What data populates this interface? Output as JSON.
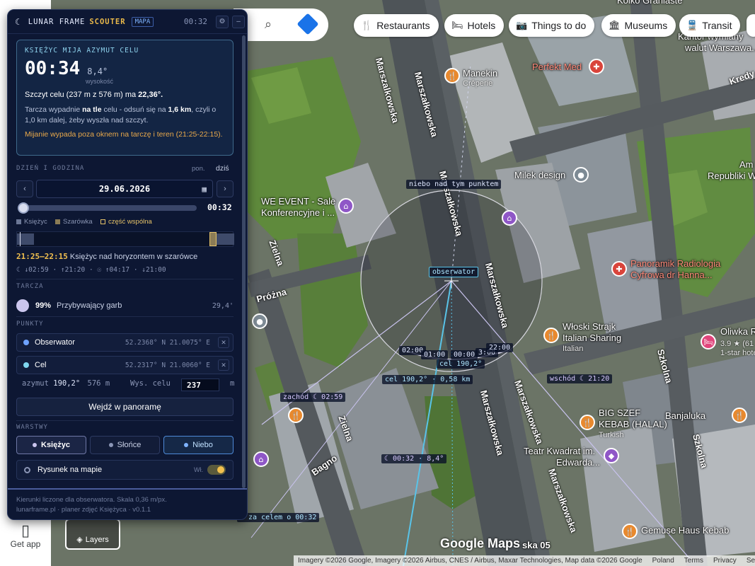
{
  "map": {
    "chips": [
      {
        "icon": "🍴",
        "label": "Restaurants"
      },
      {
        "icon": "🛏",
        "label": "Hotels"
      },
      {
        "icon": "📷",
        "label": "Things to do"
      },
      {
        "icon": "🏛",
        "label": "Museums"
      },
      {
        "icon": "🚆",
        "label": "Transit"
      }
    ],
    "streets": {
      "marsz1": "Marszalkowska",
      "marsz2": "Marszałkowska",
      "marsz3": "Marszałkowska",
      "marsz4": "Marszałkowska",
      "marsz5": "Marszałkowska",
      "marsz6": "Marszałkowska",
      "marsz7": "Marszałkowska",
      "zielna1": "Zielna",
      "zielna2": "Zielna",
      "prozna": "Próżna",
      "bagno": "Bagno",
      "szkolna1": "Szkolna",
      "szkolna2": "Szkolna",
      "kredy": "Kredy",
      "marsz_bottom": "ska 05"
    },
    "pois": {
      "koiko": "Koiko Graniaste",
      "kantor1": "Kantor wymiany",
      "kantor2": "walut Warszawa...",
      "manekin": "Manekin",
      "manekin_sub": "Crêperie",
      "perfekt": "Perfekt Med",
      "milek": "Milek design",
      "ambasada1": "Am",
      "ambasada2": "Republiki W",
      "wevent1": "WE EVENT - Sale",
      "wevent2": "Konferencyjne i ...",
      "panoramik1": "Panoramik Radiologia",
      "panoramik2": "Cyfrowa dr Hanna...",
      "wloski1": "Włoski Strajk",
      "wloski2": "Italian Sharing",
      "wloski_sub": "Italian",
      "oliwka1": "Oliwka R",
      "oliwka_rating": "3.9 ★ (61",
      "oliwka_sub": "1-star hote",
      "bigszef1": "BIG SZEF",
      "bigszef2": "KEBAB (HALAL)",
      "bigszef_sub": "Turkish",
      "banjaluka": "Banjaluka",
      "teatr1": "Teatr Kwadrat im.",
      "teatr2": "Edwarda...",
      "gemuse": "Gemuse Haus Kebab"
    },
    "overlay": {
      "niebo": "niebo nad tym punktem",
      "obserwator": "obserwator",
      "t0200a": "02:00",
      "t0100": "01:00",
      "t0000": "00:00",
      "t0300": "3:00",
      "t2200": "22:00",
      "cel_az": "cel 190,2°",
      "cel_km": "cel 190,2° · 0,58 km",
      "wschod": "wschód ☾ 21:20",
      "zachod": "zachód ☾ 02:59",
      "moon_now": "☾ 00:32 · 8,4°",
      "za_celem": "☾ za celem o 00:32"
    },
    "get_app": "Get app",
    "layers": "Layers",
    "google": "Google Maps",
    "attribution": [
      "Imagery ©2026 Google, Imagery ©2026 Airbus, CNES / Airbus, Maxar Technologies, Map data ©2026 Google",
      "Poland",
      "Terms",
      "Privacy",
      "Se"
    ]
  },
  "panel": {
    "brand": "LUNAR FRAME",
    "brand2": "SCOUTER",
    "mapa": "MAPA",
    "time": "00:32",
    "alert": {
      "kicker": "KSIĘŻYC MIJA AZYMUT CELU",
      "time": "00:34",
      "alt": "8,4°",
      "alt_label": "wysokość",
      "line1_a": "Szczyt celu (237 m z 576 m) ma ",
      "line1_b": "22,36°.",
      "line2_a": "Tarcza wypadnie ",
      "line2_b": "na tle",
      "line2_c": " celu - odsuń się na ",
      "line2_d": "1,6 km",
      "line2_e": ", czyli o 1,0 km dalej, żeby wyszła nad szczyt.",
      "line3": "Mijanie wypada poza oknem na tarczę i teren (21:25-22:15)."
    },
    "date_section": {
      "label": "DZIEŃ I GODZINA",
      "day": "pon.",
      "today": "dziś",
      "date": "29.06.2026",
      "slider_time": "00:32",
      "legend_moon": "Księżyc",
      "legend_twilight": "Szarówka",
      "legend_common": "część wspólna",
      "window": "21:25–22:15",
      "window_text": " Księżyc nad horyzontem w szarówce",
      "rises": "☾ ↓02:59 · ↑21:20 · ☉ ↑04:17 · ↓21:00"
    },
    "phase": {
      "label": "TARCZA",
      "pct": "99%",
      "name": "Przybywający garb",
      "size": "29,4'"
    },
    "points": {
      "label": "PUNKTY",
      "observer": {
        "name": "Obserwator",
        "coord": "52.2368° N 21.0075° E"
      },
      "target": {
        "name": "Cel",
        "coord": "52.2317° N 21.0060° E"
      },
      "az_label": "azymut",
      "az": "190,2°",
      "dist": "576 m",
      "h_label": "Wys. celu",
      "h_value": "237",
      "h_unit": "m",
      "panorama": "Wejdź w panoramę"
    },
    "layers": {
      "label": "WARSTWY",
      "moon": "Księżyc",
      "sun": "Słońce",
      "sky": "Niebo",
      "drawing": "Rysunek na mapie",
      "drawing_state": "Wł."
    },
    "footer": {
      "line1": "Kierunki liczone dla obserwatora. Skala 0,36 m/px.",
      "line2": "lunarframe.pl · planer zdjęć Księżyca · v0.1.1"
    }
  }
}
